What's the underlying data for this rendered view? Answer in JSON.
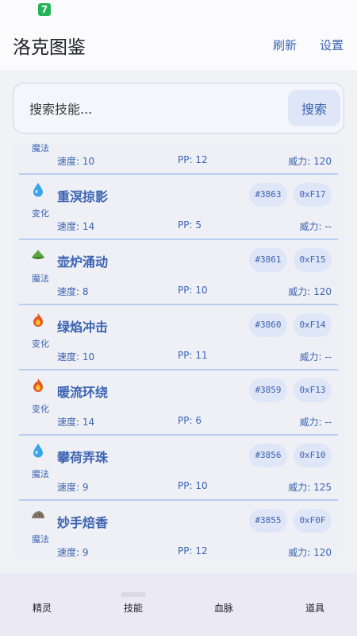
{
  "header": {
    "title": "洛克图鉴",
    "refresh_label": "刷新",
    "settings_label": "设置"
  },
  "search": {
    "placeholder": "搜索技能...",
    "button_label": "搜索"
  },
  "stat_labels": {
    "speed": "速度",
    "pp": "PP",
    "power": "威力"
  },
  "skills": [
    {
      "name": "",
      "category": "魔法",
      "icon": "none",
      "id": "",
      "hex": "",
      "speed": "10",
      "pp": "12",
      "power": "120"
    },
    {
      "name": "重溟掠影",
      "category": "变化",
      "icon": "water-drop-icon",
      "id": "#3863",
      "hex": "0xF17",
      "speed": "14",
      "pp": "5",
      "power": "--"
    },
    {
      "name": "壶炉涌动",
      "category": "魔法",
      "icon": "leaf-icon",
      "id": "#3861",
      "hex": "0xF15",
      "speed": "8",
      "pp": "10",
      "power": "120"
    },
    {
      "name": "绿焰冲击",
      "category": "变化",
      "icon": "fire-icon",
      "id": "#3860",
      "hex": "0xF14",
      "speed": "10",
      "pp": "11",
      "power": "--"
    },
    {
      "name": "暖流环绕",
      "category": "变化",
      "icon": "fire-icon",
      "id": "#3859",
      "hex": "0xF13",
      "speed": "14",
      "pp": "6",
      "power": "--"
    },
    {
      "name": "攀荷弄珠",
      "category": "魔法",
      "icon": "water-drop-icon",
      "id": "#3856",
      "hex": "0xF10",
      "speed": "9",
      "pp": "10",
      "power": "125"
    },
    {
      "name": "妙手焙香",
      "category": "魔法",
      "icon": "rock-icon",
      "id": "#3855",
      "hex": "0xF0F",
      "speed": "9",
      "pp": "12",
      "power": "120"
    }
  ],
  "bottom_nav": {
    "items": [
      "精灵",
      "技能",
      "血脉",
      "道具"
    ],
    "active_index": 1
  },
  "colors": {
    "accent": "#3c63b2",
    "divider": "#b9cdf2",
    "tag_bg": "#dfe6f7"
  }
}
